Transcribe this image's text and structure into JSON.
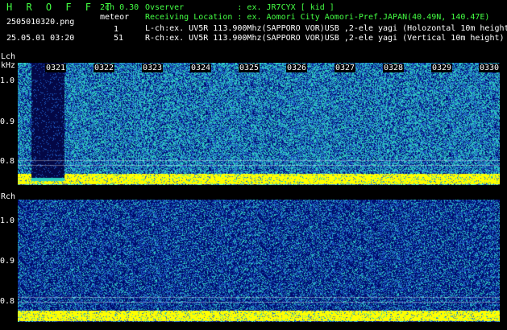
{
  "header": {
    "title": "H R O F F T",
    "filename": "2505010320.png",
    "datetime": "25.05.01 03:20",
    "mode": "2ch 0.30",
    "meteor_label": "meteor",
    "lch_count": "1",
    "rch_count": "51"
  },
  "info": {
    "observer": "Ovserver           : ex. JR7CYX [ kid ]",
    "location": "Receiving Location : ex. Aomori City Aomori-Pref.JAPAN(40.49N, 140.47E)",
    "lch": "L-ch:ex. UV5R 113.900Mhz(SAPPORO VOR)USB ,2-ele yagi (Holozontal 10m height)",
    "rch": "R-ch:ex. UV5R 113.900Mhz(SAPPORO VOR)USB ,2-ele yagi (Vertical 10m height)"
  },
  "lch_panel": {
    "channel_label": "Lch",
    "unit_label": "kHz",
    "ticks": [
      "1.0",
      "0.9",
      "0.8"
    ]
  },
  "rch_panel": {
    "channel_label": "Rch",
    "ticks": [
      "1.0",
      "0.9",
      "0.8"
    ]
  },
  "minute_labels": [
    "0321",
    "0322",
    "0323",
    "0324",
    "0325",
    "0326",
    "0327",
    "0328",
    "0329",
    "0330"
  ],
  "colors": {
    "background": "#000000",
    "text_green": "#44ff44",
    "text_white": "#ffffff",
    "noise_low": "#000c6e",
    "noise_mid": "#1f5fc8",
    "noise_high": "#2fd0c0",
    "carrier": "#ffff00"
  }
}
